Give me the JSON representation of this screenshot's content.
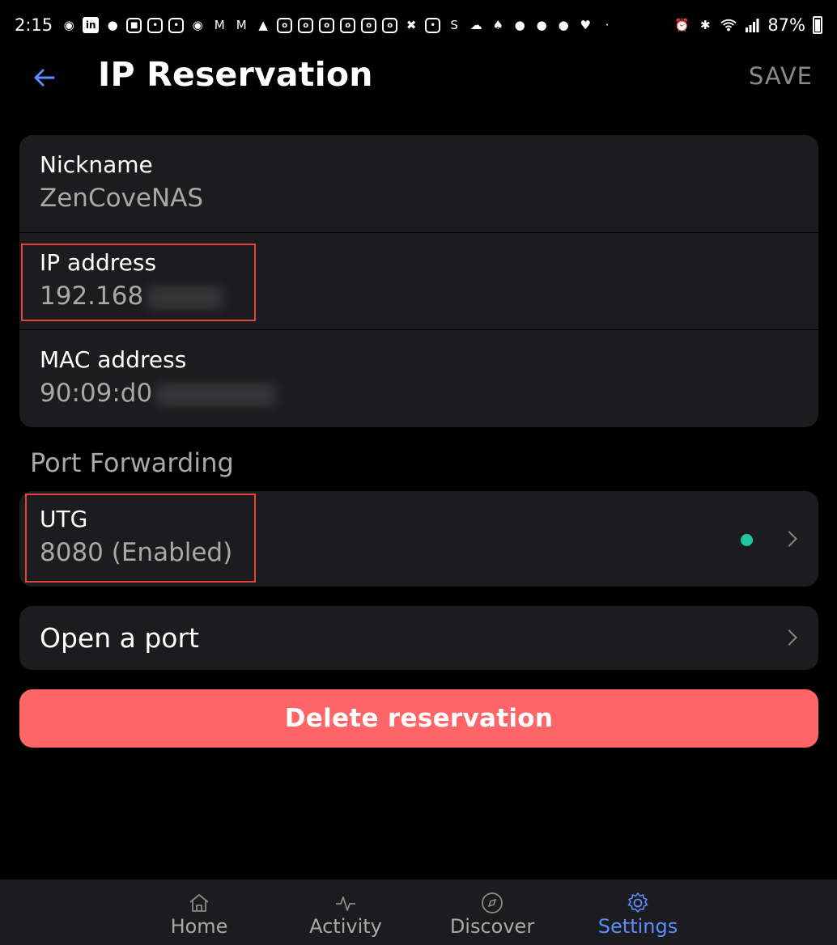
{
  "status_bar": {
    "time": "2:15",
    "battery": "87%",
    "notification_icons": [
      "chat-bubble-icon",
      "linkedin-icon",
      "facebook-icon",
      "app-icon",
      "mlb-icon",
      "mlb-icon",
      "app-icon",
      "gmail-icon",
      "gmail-icon",
      "app-icon",
      "instagram-icon",
      "instagram-icon",
      "instagram-icon",
      "instagram-icon",
      "instagram-icon",
      "instagram-icon",
      "app-icon",
      "mlb-icon",
      "s-icon",
      "cloud-icon",
      "app-icon",
      "chat-bubble-icon",
      "chat-bubble-icon",
      "chat-bubble-icon",
      "heart-icon",
      "dot-icon"
    ]
  },
  "header": {
    "title": "IP Reservation",
    "save_label": "SAVE"
  },
  "fields": {
    "nickname": {
      "label": "Nickname",
      "value": "ZenCoveNAS"
    },
    "ip": {
      "label": "IP address",
      "value": "192.168"
    },
    "mac": {
      "label": "MAC address",
      "value": "90:09:d0"
    }
  },
  "port_forwarding": {
    "section_title": "Port Forwarding",
    "rule": {
      "name": "UTG",
      "detail": "8080  (Enabled)",
      "status_color": "#1fc7a0"
    },
    "open_port_label": "Open a port"
  },
  "delete_label": "Delete reservation",
  "colors": {
    "background": "#000000",
    "card": "#1c1c1e",
    "accent": "#5b8cff",
    "danger": "#ff6466",
    "highlight": "#e04343"
  },
  "nav": {
    "items": [
      {
        "label": "Home",
        "icon": "home-icon"
      },
      {
        "label": "Activity",
        "icon": "activity-icon"
      },
      {
        "label": "Discover",
        "icon": "compass-icon"
      },
      {
        "label": "Settings",
        "icon": "gear-icon"
      }
    ],
    "active": "Settings"
  }
}
